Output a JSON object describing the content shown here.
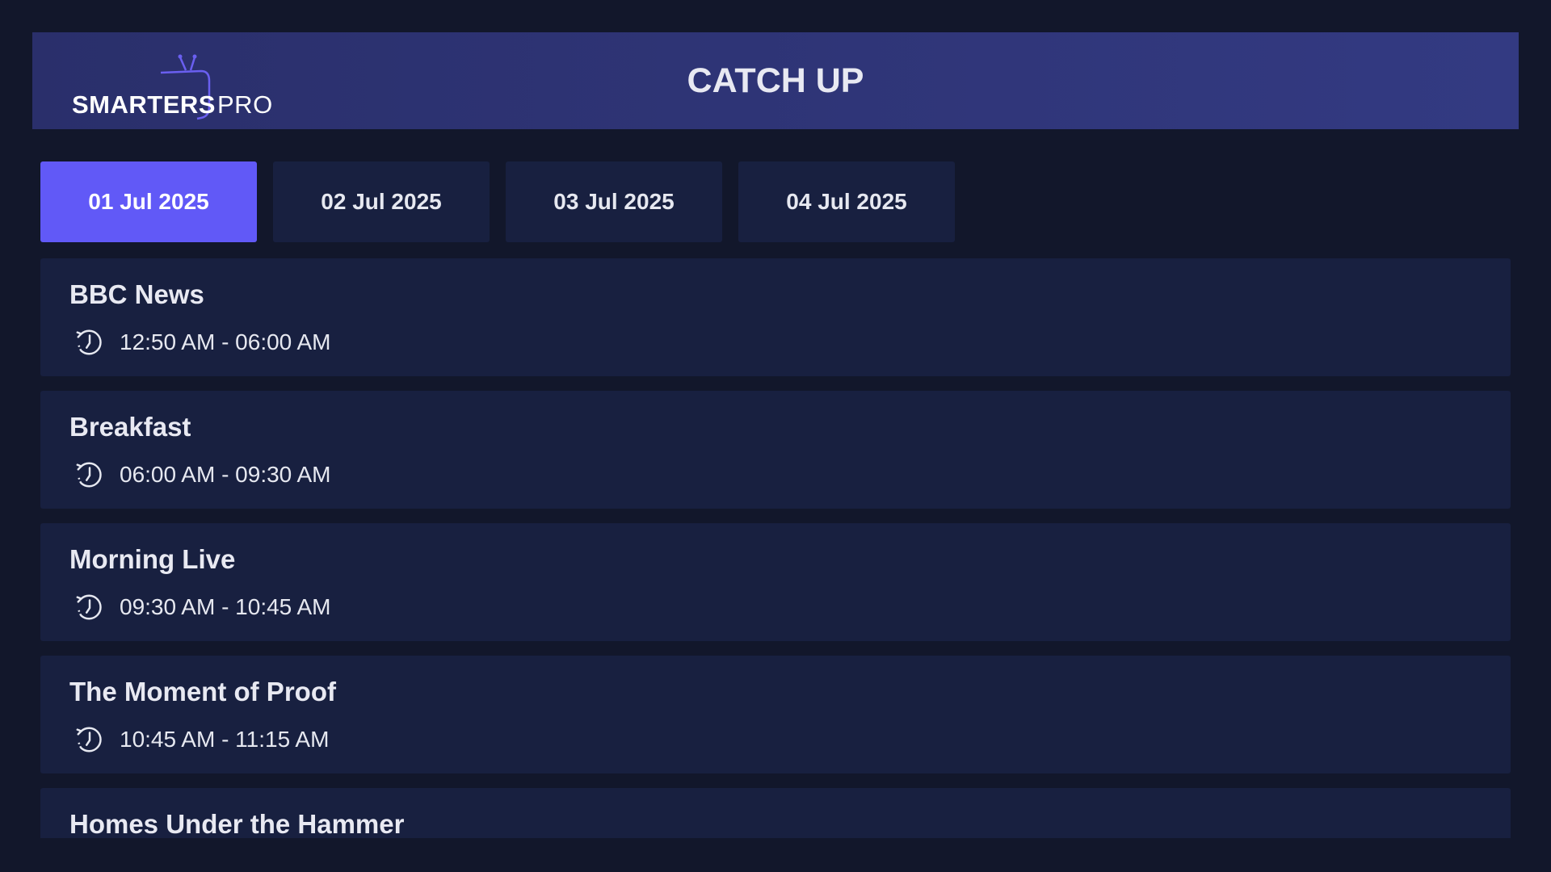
{
  "header": {
    "logo": {
      "strong": "SMARTERS",
      "light": "PRO"
    },
    "title": "CATCH UP"
  },
  "tabs": [
    {
      "label": "01 Jul 2025",
      "active": true
    },
    {
      "label": "02 Jul 2025",
      "active": false
    },
    {
      "label": "03 Jul 2025",
      "active": false
    },
    {
      "label": "04 Jul 2025",
      "active": false
    }
  ],
  "programs": [
    {
      "title": "BBC News",
      "time": "12:50 AM - 06:00 AM",
      "icon": "history-icon"
    },
    {
      "title": "Breakfast",
      "time": "06:00 AM - 09:30 AM",
      "icon": "history-icon"
    },
    {
      "title": "Morning Live",
      "time": "09:30 AM - 10:45 AM",
      "icon": "history-icon"
    },
    {
      "title": "The Moment of Proof",
      "time": "10:45 AM - 11:15 AM",
      "icon": "history-icon"
    },
    {
      "title": "Homes Under the Hammer",
      "time": "",
      "icon": "history-icon"
    }
  ],
  "colors": {
    "background": "#12172b",
    "header": "#2f357a",
    "accent": "#6159f7",
    "card": "#182040"
  }
}
